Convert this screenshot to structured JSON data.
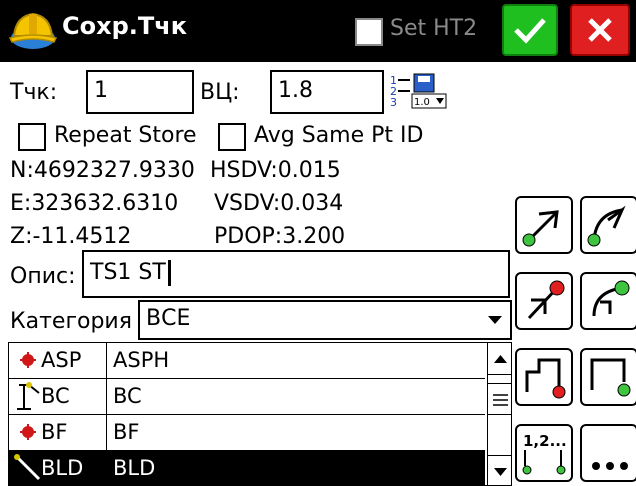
{
  "title_bar": {
    "title": "Сохр.Тчк",
    "set_ht2_label": "Set HT2",
    "set_ht2_checked": false,
    "ok_icon": "checkmark-icon",
    "close_icon": "close-icon",
    "app_icon": "hardhat-logo-icon"
  },
  "point": {
    "label": "Тчк:",
    "value": "1",
    "height_label": "ВЦ:",
    "height_value": "1.8"
  },
  "options": {
    "repeat_store_label": "Repeat Store",
    "repeat_store_checked": false,
    "avg_same_label": "Avg Same Pt ID",
    "avg_same_checked": false
  },
  "coords": {
    "n": "N:4692327.9330",
    "hsdv": "HSDV:0.015",
    "e": "E:323632.6310",
    "vsdv": "VSDV:0.034",
    "z": "Z:-11.4512",
    "pdop": "PDOP:3.200"
  },
  "description": {
    "label": "Опис:",
    "value": "TS1 ST"
  },
  "category": {
    "label": "Категория",
    "value": "ВСЕ"
  },
  "codes": [
    {
      "code": "ASP",
      "desc": "ASPH",
      "icon": "red-point-icon",
      "selected": false
    },
    {
      "code": "BC",
      "desc": "BC",
      "icon": "curb-icon",
      "selected": false
    },
    {
      "code": "BF",
      "desc": "BF",
      "icon": "red-point-icon",
      "selected": false
    },
    {
      "code": "BLD",
      "desc": "BLD",
      "icon": "line-icon",
      "selected": true
    }
  ],
  "colors": {
    "title_bg": "#000000",
    "ok_green": "#1fbf1f",
    "close_red": "#e02020",
    "selection_bg": "#000000"
  }
}
